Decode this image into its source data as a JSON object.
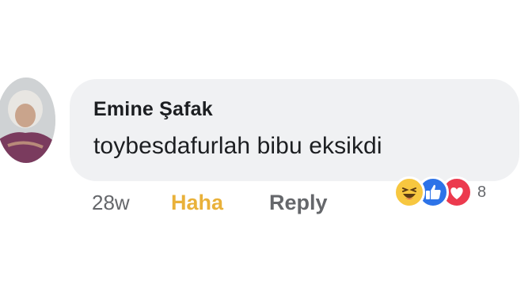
{
  "comment": {
    "author": "Emine Şafak",
    "text": "toybesdafurlah bibu eksikdi",
    "timestamp": "28w",
    "reaction_label": "Haha",
    "reply_label": "Reply",
    "reaction_count": "8",
    "reaction_icons": [
      "haha-icon",
      "like-icon",
      "love-icon"
    ],
    "colors": {
      "haha": "#e9b13a",
      "like": "#2d73e8",
      "love": "#ec3a4e",
      "bubble": "#f0f1f3"
    }
  }
}
